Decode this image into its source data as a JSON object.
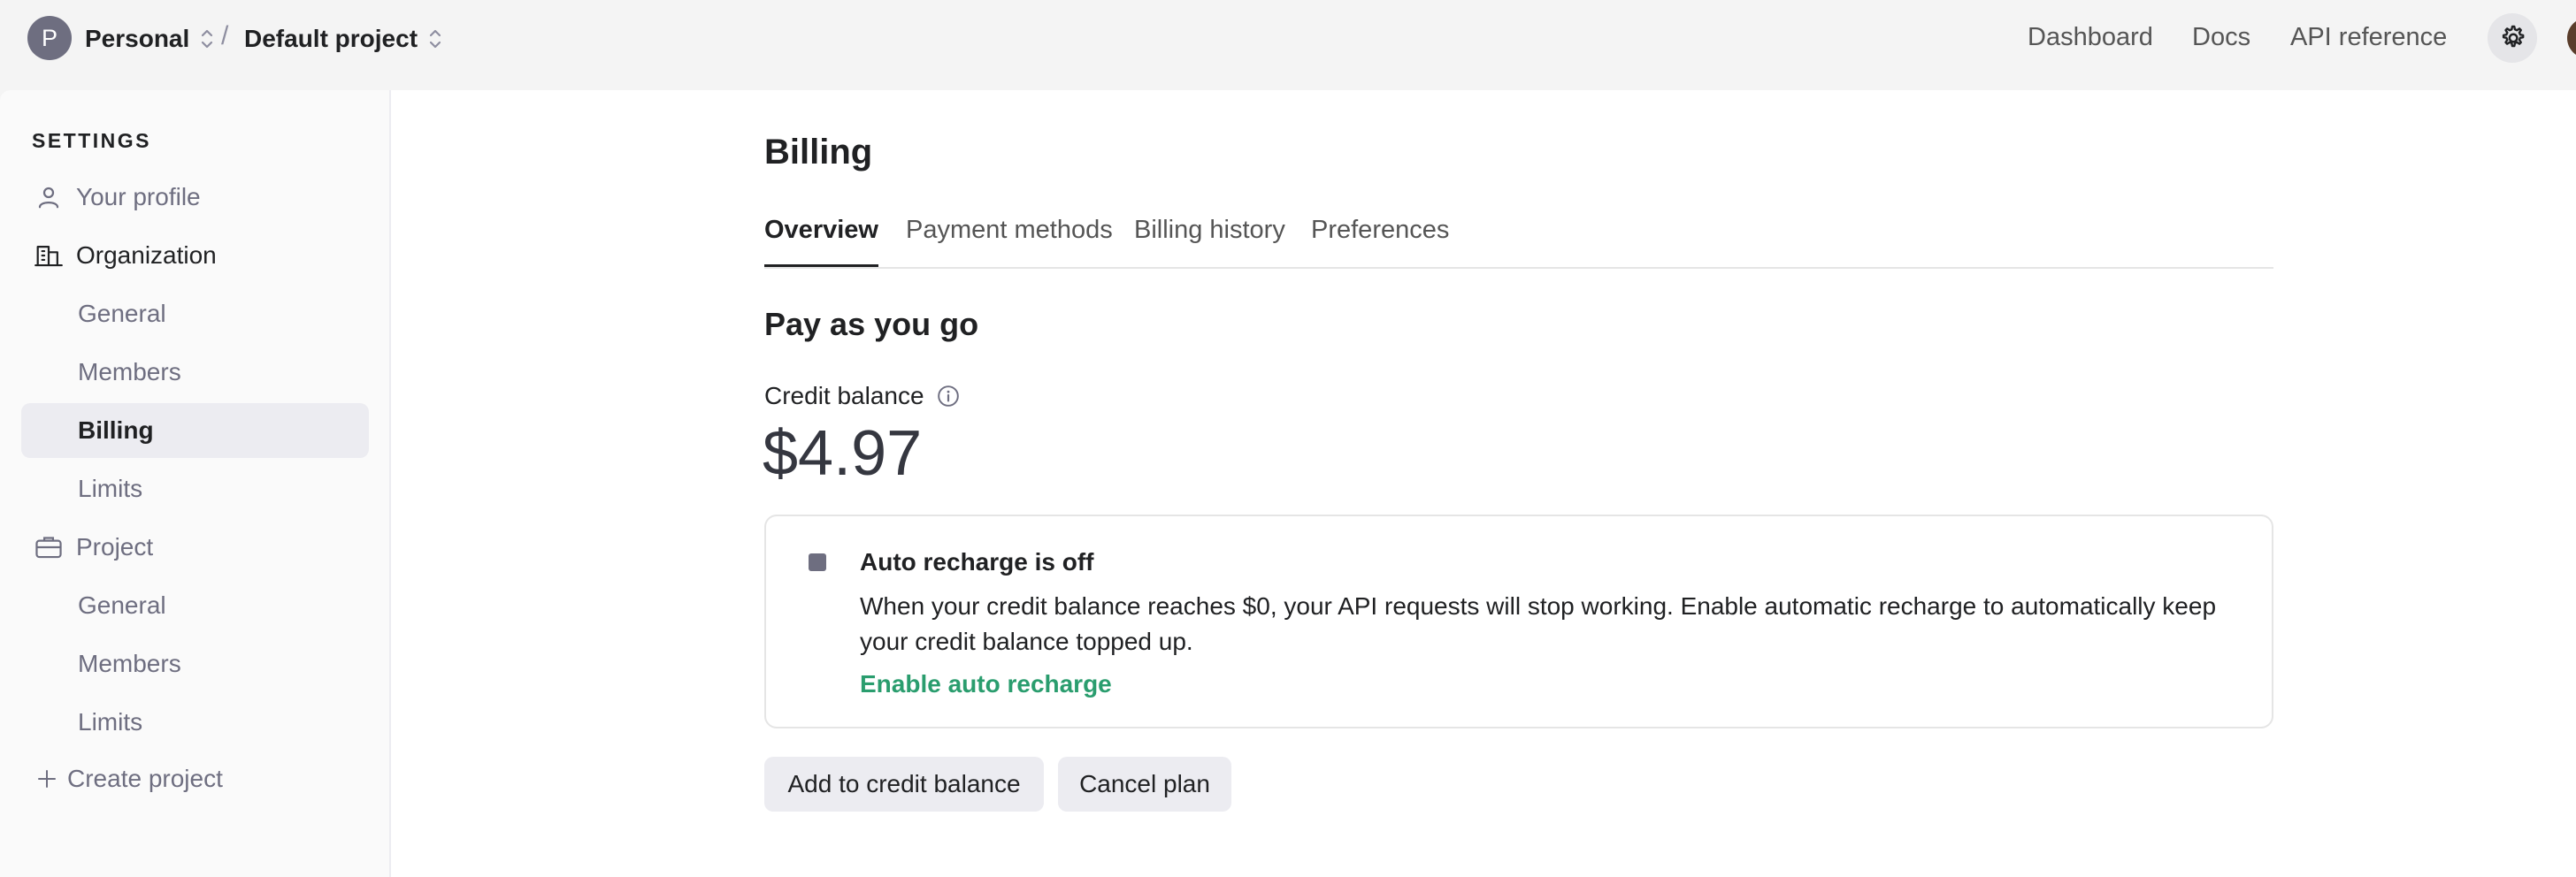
{
  "topbar": {
    "org_initial": "P",
    "org_name": "Personal",
    "separator": "/",
    "project_name": "Default project",
    "nav": [
      "Dashboard",
      "Docs",
      "API reference"
    ]
  },
  "sidebar": {
    "heading": "SETTINGS",
    "your_profile": "Your profile",
    "organization": "Organization",
    "org_items": [
      "General",
      "Members",
      "Billing",
      "Limits"
    ],
    "project": "Project",
    "project_items": [
      "General",
      "Members",
      "Limits"
    ],
    "create_project": "Create project"
  },
  "main": {
    "title": "Billing",
    "tabs": [
      "Overview",
      "Payment methods",
      "Billing history",
      "Preferences"
    ],
    "section_title": "Pay as you go",
    "credit_label": "Credit balance",
    "credit_amount": "$4.97",
    "recharge": {
      "title": "Auto recharge is off",
      "body": "When your credit balance reaches $0, your API requests will stop working. Enable automatic recharge to automatically keep your credit balance topped up.",
      "link": "Enable auto recharge"
    },
    "buttons": {
      "add_credit": "Add to credit balance",
      "cancel_plan": "Cancel plan"
    }
  },
  "colors": {
    "accent_link": "#2a9d6e",
    "org_avatar": "#6e6e80"
  }
}
